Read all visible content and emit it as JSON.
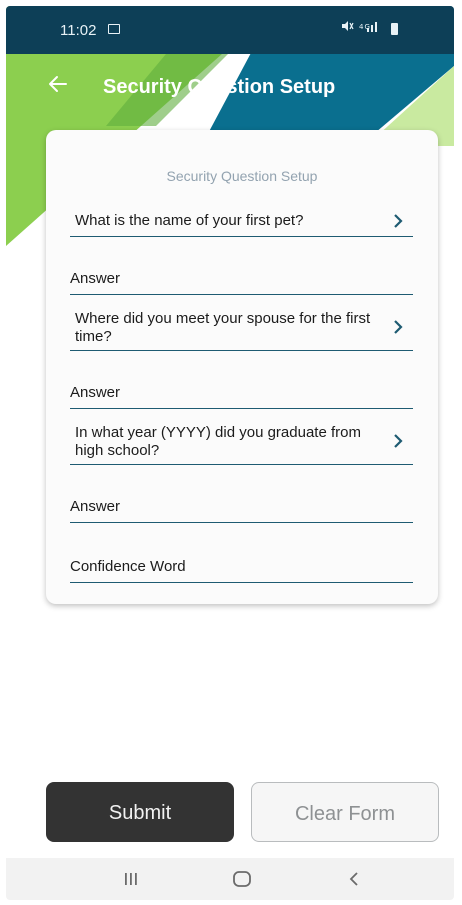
{
  "status_bar": {
    "time": "11:02",
    "icons": "📶 4G"
  },
  "header": {
    "title": "Security Question Setup"
  },
  "card": {
    "title": "Security Question Setup",
    "questions": [
      {
        "text": "What is the name of your first pet?",
        "answer_placeholder": "Answer"
      },
      {
        "text": "Where did you meet your spouse for the first time?",
        "answer_placeholder": "Answer"
      },
      {
        "text": "In what year (YYYY) did you graduate from high school?",
        "answer_placeholder": "Answer"
      }
    ],
    "confidence_placeholder": "Confidence Word"
  },
  "buttons": {
    "submit": "Submit",
    "clear": "Clear Form"
  },
  "colors": {
    "header_dark": "#0d3f57",
    "header_teal": "#0a6f8f",
    "header_green": "#8ccf4f",
    "header_light_green": "#d8f0b8",
    "underline": "#1e5b72",
    "submit_bg": "#333333"
  }
}
